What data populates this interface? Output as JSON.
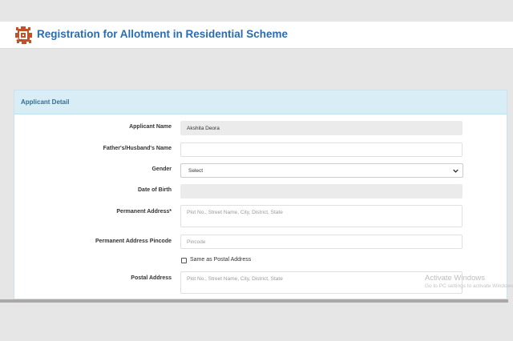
{
  "header": {
    "logo_text": "JDA",
    "title": "Registration for Allotment in Residential Scheme"
  },
  "panel": {
    "title": "Applicant Detail",
    "fields": {
      "applicant_name": {
        "label": "Applicant Name",
        "value": "Akshita Deora"
      },
      "guardian_name": {
        "label": "Father's/Husband's Name",
        "value": ""
      },
      "gender": {
        "label": "Gender",
        "value": "Select"
      },
      "dob": {
        "label": "Date of Birth",
        "value": ""
      },
      "permanent_address": {
        "label": "Permanent Address*",
        "placeholder": "Plot No., Street Name, City, District, State"
      },
      "permanent_pincode": {
        "label": "Permanent Address Pincode",
        "placeholder": "Pincode"
      },
      "same_as_postal": {
        "label": "Same as Postal Address",
        "checked": false
      },
      "postal_address": {
        "label": "Postal Address",
        "placeholder": "Plot No., Street Name, City, District, State"
      }
    }
  },
  "watermark": {
    "line1": "Activate Windows",
    "line2": "Go to PC settings to activate Windows."
  },
  "colors": {
    "title_blue": "#2b6cb0",
    "panel_head_bg": "#d9edf7",
    "panel_head_text": "#31708f",
    "logo_red": "#b5451b"
  },
  "icons": {
    "logo": "jda-emblem-icon",
    "select_arrow": "chevron-down-icon"
  }
}
